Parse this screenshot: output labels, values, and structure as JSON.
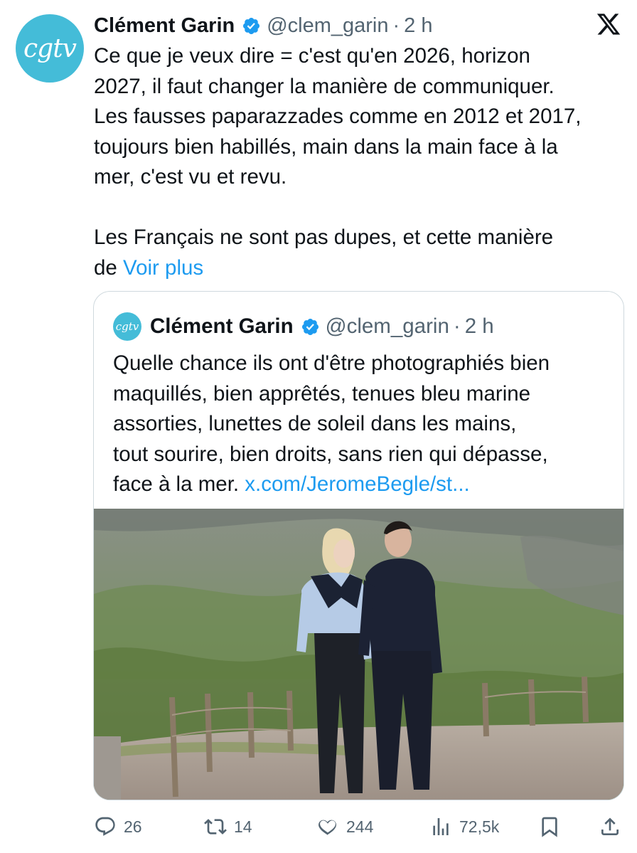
{
  "tweet": {
    "avatar_text": "cgtv",
    "author_name": "Clément Garin",
    "author_handle": "@clem_garin",
    "separator": "·",
    "time": "2 h",
    "text_para1": "Ce que je veux dire = c'est qu'en 2026, horizon\n2027, il faut changer la manière de communiquer.\nLes fausses paparazzades comme en 2012 et 2017,\ntoujours bien habillés, main dans la main face à la\nmer, c'est vu et revu.",
    "text_para2": "Les Français ne sont pas dupes, et cette manière\nde ",
    "see_more": "Voir plus"
  },
  "quote": {
    "avatar_text": "cgtv",
    "author_name": "Clément Garin",
    "author_handle": "@clem_garin",
    "separator": "·",
    "time": "2 h",
    "text": "Quelle chance ils ont d'être photographiés bien\nmaquillés, bien apprêtés, tenues bleu marine\nassorties, lunettes de soleil dans les mains,\ntout sourire, bien droits, sans rien qui dépasse,\nface à la mer. ",
    "link": "x.com/JeromeBegle/st..."
  },
  "actions": {
    "replies": "26",
    "reposts": "14",
    "likes": "244",
    "views": "72,5k"
  },
  "icons": {
    "verified": "verified-badge-icon",
    "brand": "x-logo-icon",
    "reply": "reply-icon",
    "repost": "repost-icon",
    "like": "like-icon",
    "views": "views-icon",
    "bookmark": "bookmark-icon",
    "share": "share-icon"
  },
  "colors": {
    "accent": "#1d9bf0",
    "avatar": "#44bcd8",
    "muted": "#536471"
  }
}
